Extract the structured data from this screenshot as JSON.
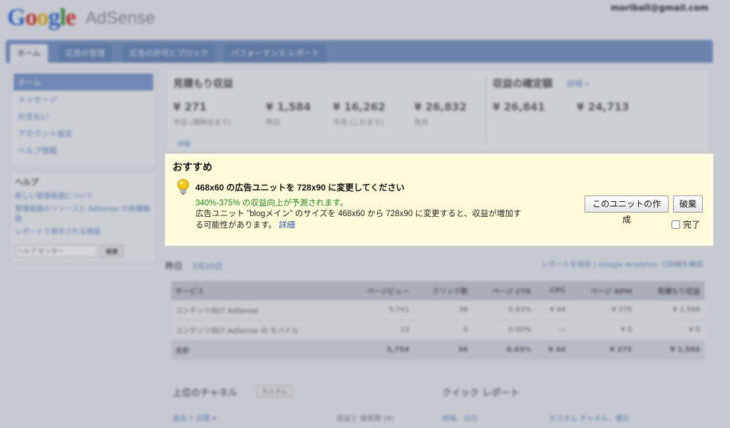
{
  "app": {
    "logo_google": "Google",
    "logo_product": "AdSense"
  },
  "header": {
    "email": "moriball@gmail.com",
    "links": "",
    "note": ""
  },
  "tabs": [
    {
      "label": "ホーム"
    },
    {
      "label": "広告の管理"
    },
    {
      "label": "広告の許可とブロック"
    },
    {
      "label": "パフォーマンス レポート"
    }
  ],
  "sidebar": {
    "items": [
      {
        "label": "ホーム"
      },
      {
        "label": "メッセージ"
      },
      {
        "label": "お支払い"
      },
      {
        "label": "アカウント設定"
      },
      {
        "label": "ヘルプ情報"
      }
    ],
    "help": {
      "title": "ヘルプ",
      "links": [
        "新しい管理画面について",
        "管理画面のリソースと AdSense の各種機能",
        "レポートで表示される用語"
      ],
      "search_placeholder": "ヘルプ センター",
      "search_button": "検索"
    }
  },
  "earnings": {
    "title": "見積もり収益",
    "items": [
      {
        "value": "¥ 271",
        "label": "今日 (現時点まで)"
      },
      {
        "value": "¥ 1,584",
        "label": "昨日"
      },
      {
        "value": "¥ 16,262",
        "label": "今月 (これまで)"
      },
      {
        "value": "¥ 26,832",
        "label": "先月"
      }
    ],
    "note": "",
    "note_link": "詳細",
    "finalized_title": "収益の確定額",
    "finalized_more": "詳細 »",
    "finalized_items": [
      {
        "value": "¥ 26,841",
        "label": ""
      },
      {
        "value": "¥ 24,713",
        "label": ""
      }
    ]
  },
  "recommendation": {
    "title": "おすすめ",
    "headline": "468x60 の広告ユニットを 728x90 に変更してください",
    "prediction": "340%-375% の収益向上が予測されます。",
    "body": "広告ユニット \"blogメイン\" のサイズを 468x60 から 728x90 に変更すると、収益が増加する可能性があります。",
    "details_link": "詳細",
    "create_button": "このユニットの作成",
    "dismiss_button": "破棄",
    "done_label": "完了"
  },
  "yesterday": {
    "title": "昨日",
    "date": "3月20日",
    "links": "レポートを保存 | Google Analytics で詳細を確認",
    "columns": [
      "サービス",
      "ページビュー",
      "クリック数",
      "ページ CTR",
      "CPC",
      "ページ RPM",
      "見積もり収益"
    ],
    "rows": [
      [
        "コンテンツ向け AdSense",
        "5,741",
        "36",
        "0.63%",
        "¥ 44",
        "¥ 275",
        "¥ 1,584"
      ],
      [
        "コンテンツ向け AdSense の モバイル",
        "13",
        "0",
        "0.00%",
        "—",
        "¥ 0",
        "¥ 0"
      ]
    ],
    "total": [
      "合計",
      "5,754",
      "36",
      "0.63%",
      "¥ 44",
      "¥ 275",
      "¥ 1,584"
    ]
  },
  "lower": {
    "channels_title": "上位のチャネル",
    "channels_select": "カスタム",
    "quick_title": "クイック レポート",
    "row_links": [
      "過去 7 日間 ▾",
      "収益と 検索数 (¥)",
      "地域、日付",
      "カスタム チャネル、曜日"
    ]
  },
  "colors": {
    "tab_bar": "#7a97c6",
    "recommend_bg": "#fffbd9",
    "prediction_green": "#1f8a1f",
    "link_blue": "#2255aa"
  }
}
